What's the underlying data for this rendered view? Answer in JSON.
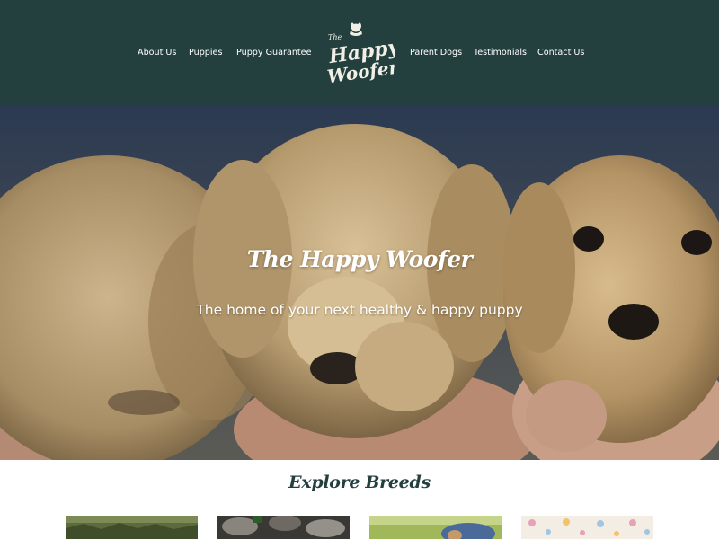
{
  "nav": {
    "left": [
      "About Us",
      "Puppies",
      "Puppy Guarantee"
    ],
    "right": [
      "Parent Dogs",
      "Testimonials",
      "Contact Us"
    ]
  },
  "logo": {
    "line1": "The",
    "line2": "Happy",
    "line3": "Woofer"
  },
  "hero": {
    "title": "The Happy Woofer",
    "subtitle": "The home of your next healthy & happy puppy"
  },
  "explore": {
    "title": "Explore Breeds",
    "cards": [
      {
        "kind": "grass-photo"
      },
      {
        "kind": "rocks-photo"
      },
      {
        "kind": "lawn-photo"
      },
      {
        "kind": "floral-photo"
      }
    ]
  },
  "colors": {
    "header_bg": "#23403f",
    "heading": "#23403f",
    "nav_text": "#ffffff"
  }
}
